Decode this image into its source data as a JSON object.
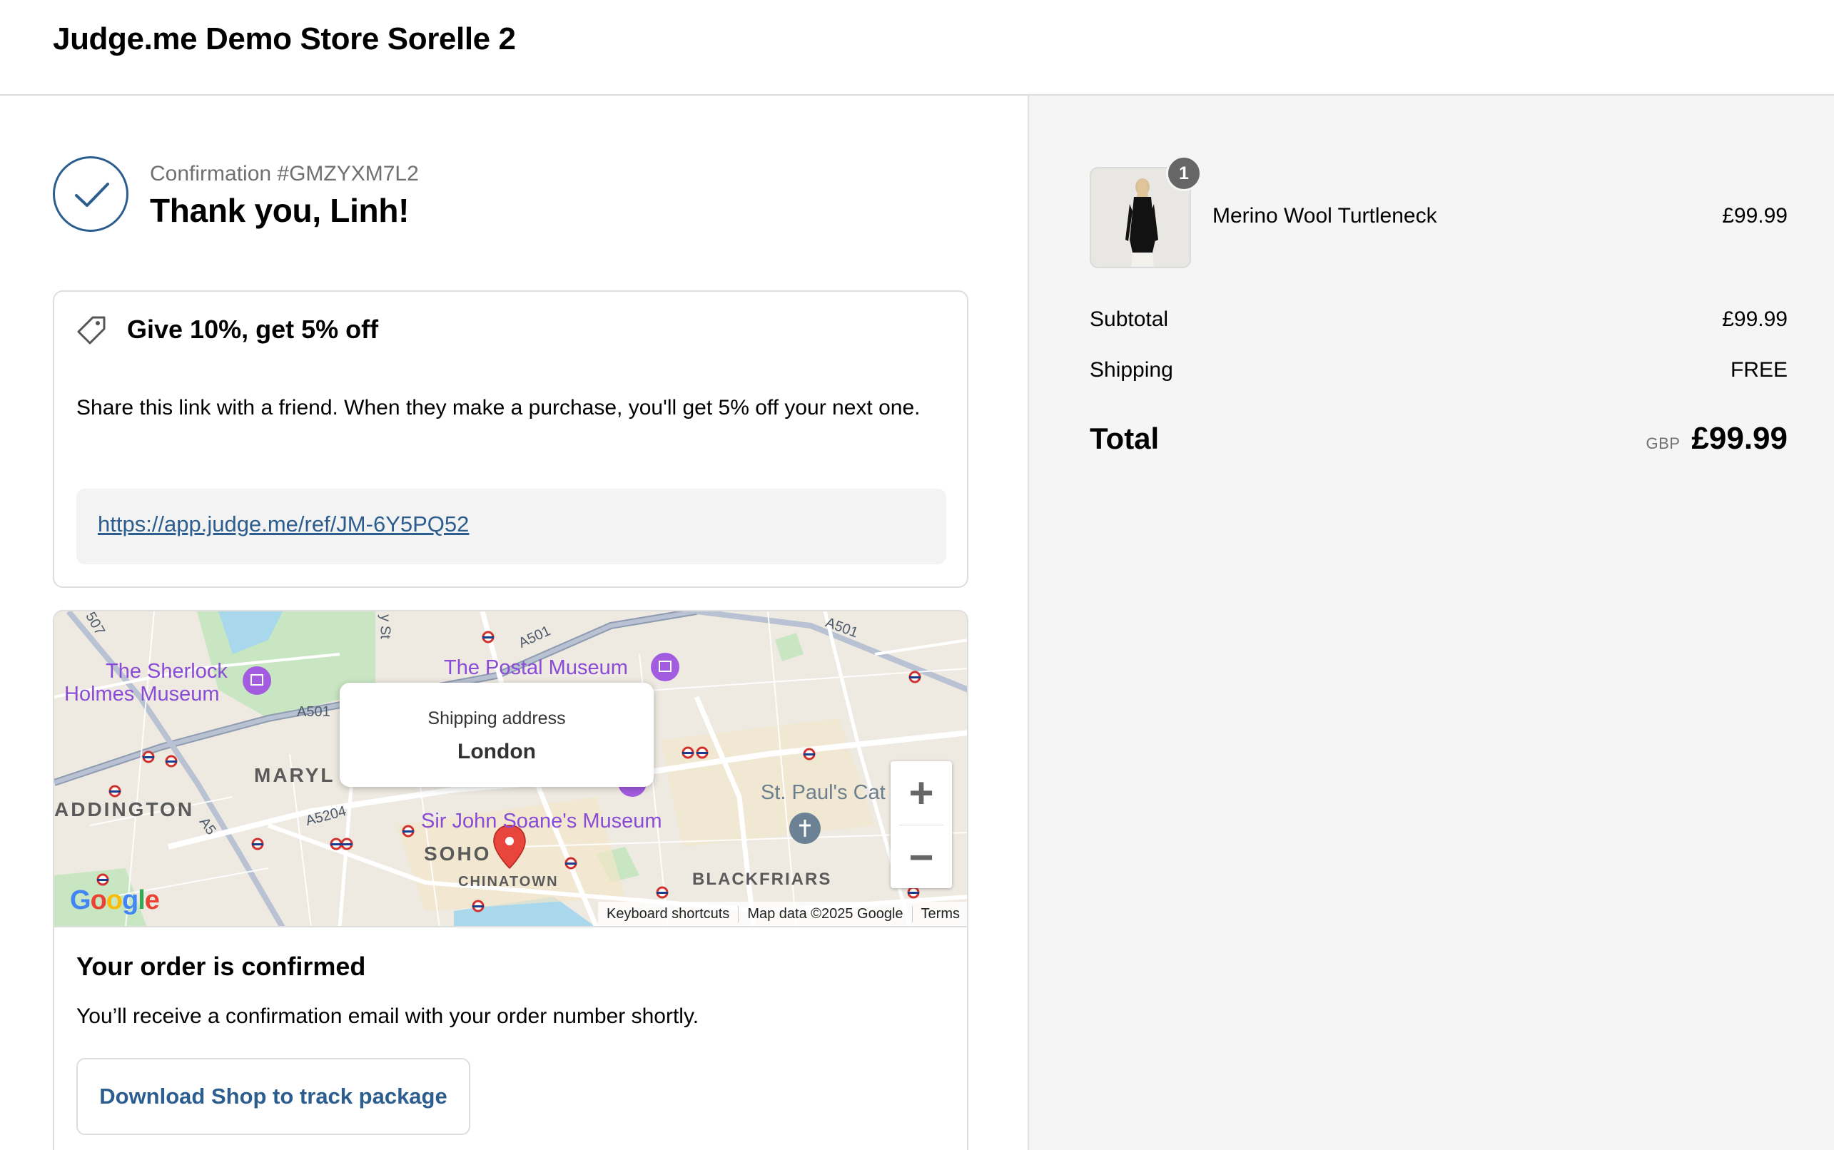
{
  "header": {
    "store_name": "Judge.me Demo Store Sorelle 2"
  },
  "confirmation": {
    "number": "Confirmation #GMZYXM7L2",
    "thank_you": "Thank you, Linh!"
  },
  "referral": {
    "title": "Give 10%, get 5% off",
    "text": "Share this link with a friend. When they make a purchase, you'll get 5% off your next one.",
    "link": "https://app.judge.me/ref/JM-6Y5PQ52"
  },
  "map": {
    "popup_title": "Shipping address",
    "popup_city": "London",
    "labels": {
      "sherlock_1": "The Sherlock",
      "sherlock_2": "Holmes Museum",
      "postal": "The Postal Museum",
      "soane": "Sir John Soane's Museum",
      "stpauls": "St. Paul's Cat",
      "marylebone": "MARYL",
      "paddington": "ADDINGTON",
      "soho": "SOHO",
      "chinatown": "CHINATOWN",
      "blackfriars": "BLACKFRIARS",
      "a501_a": "A501",
      "a501_b": "A501",
      "a501_c": "A501",
      "a5204": "A5204",
      "a5": "A5",
      "st": "y St",
      "n507": "507"
    },
    "zoom_in": "+",
    "zoom_out": "−",
    "attribution": [
      "Keyboard shortcuts",
      "Map data ©2025 Google",
      "Terms"
    ],
    "logo": "Google"
  },
  "order_status": {
    "title": "Your order is confirmed",
    "text": "You’ll receive a confirmation email with your order number shortly.",
    "button": "Download Shop to track package"
  },
  "summary": {
    "item": {
      "name": "Merino Wool Turtleneck",
      "price": "£99.99",
      "quantity": "1"
    },
    "subtotal_label": "Subtotal",
    "subtotal_value": "£99.99",
    "shipping_label": "Shipping",
    "shipping_value": "FREE",
    "total_label": "Total",
    "currency": "GBP",
    "total_value": "£99.99"
  },
  "colors": {
    "accent": "#2c5d8f",
    "summary_bg": "#f5f5f5",
    "badge": "#666666",
    "map_pin": "#e8453c",
    "poi": "#8a4bd6"
  },
  "icons": {
    "check": "check-icon",
    "tag": "tag-icon",
    "pin": "map-pin-icon"
  }
}
